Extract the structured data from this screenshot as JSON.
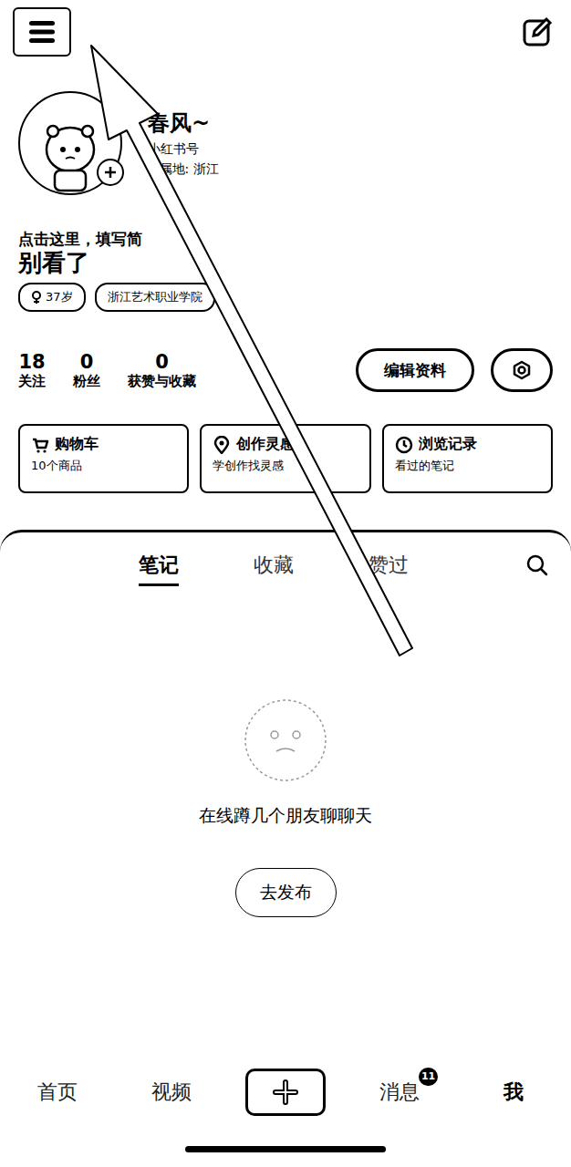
{
  "profile": {
    "name": "春风~",
    "id_label": "小红书号",
    "ip": "IP属地: 浙江",
    "bio_hint": "点击这里，填写简",
    "overlay_text": "别看了",
    "tags": [
      "37岁",
      "浙江艺术职业学院"
    ]
  },
  "stats": [
    {
      "value": "18",
      "label": "关注"
    },
    {
      "value": "0",
      "label": "粉丝"
    },
    {
      "value": "0",
      "label": "获赞与收藏"
    }
  ],
  "buttons": [
    "编辑资料"
  ],
  "cards": [
    {
      "title": "购物车",
      "subtitle": "10个商品",
      "kind": "cart"
    },
    {
      "title": "创作灵感",
      "subtitle": "学创作找灵感",
      "kind": "pin"
    },
    {
      "title": "浏览记录",
      "subtitle": "看过的笔记",
      "kind": "clock"
    }
  ],
  "tabs": [
    {
      "label": "笔记",
      "selected": true
    },
    {
      "label": "收藏",
      "selected": false
    },
    {
      "label": "赞过",
      "selected": false
    }
  ],
  "empty": {
    "message": "在线蹲几个朋友聊聊天",
    "button": "去发布"
  },
  "nav": [
    {
      "label": "首页",
      "kind": "text",
      "selected": false,
      "badge": ""
    },
    {
      "label": "视频",
      "kind": "text",
      "selected": false,
      "badge": ""
    },
    {
      "label": "",
      "kind": "plus",
      "selected": false,
      "badge": ""
    },
    {
      "label": "消息",
      "kind": "text",
      "selected": false,
      "badge": "11"
    },
    {
      "label": "我",
      "kind": "text",
      "selected": true,
      "badge": ""
    }
  ]
}
